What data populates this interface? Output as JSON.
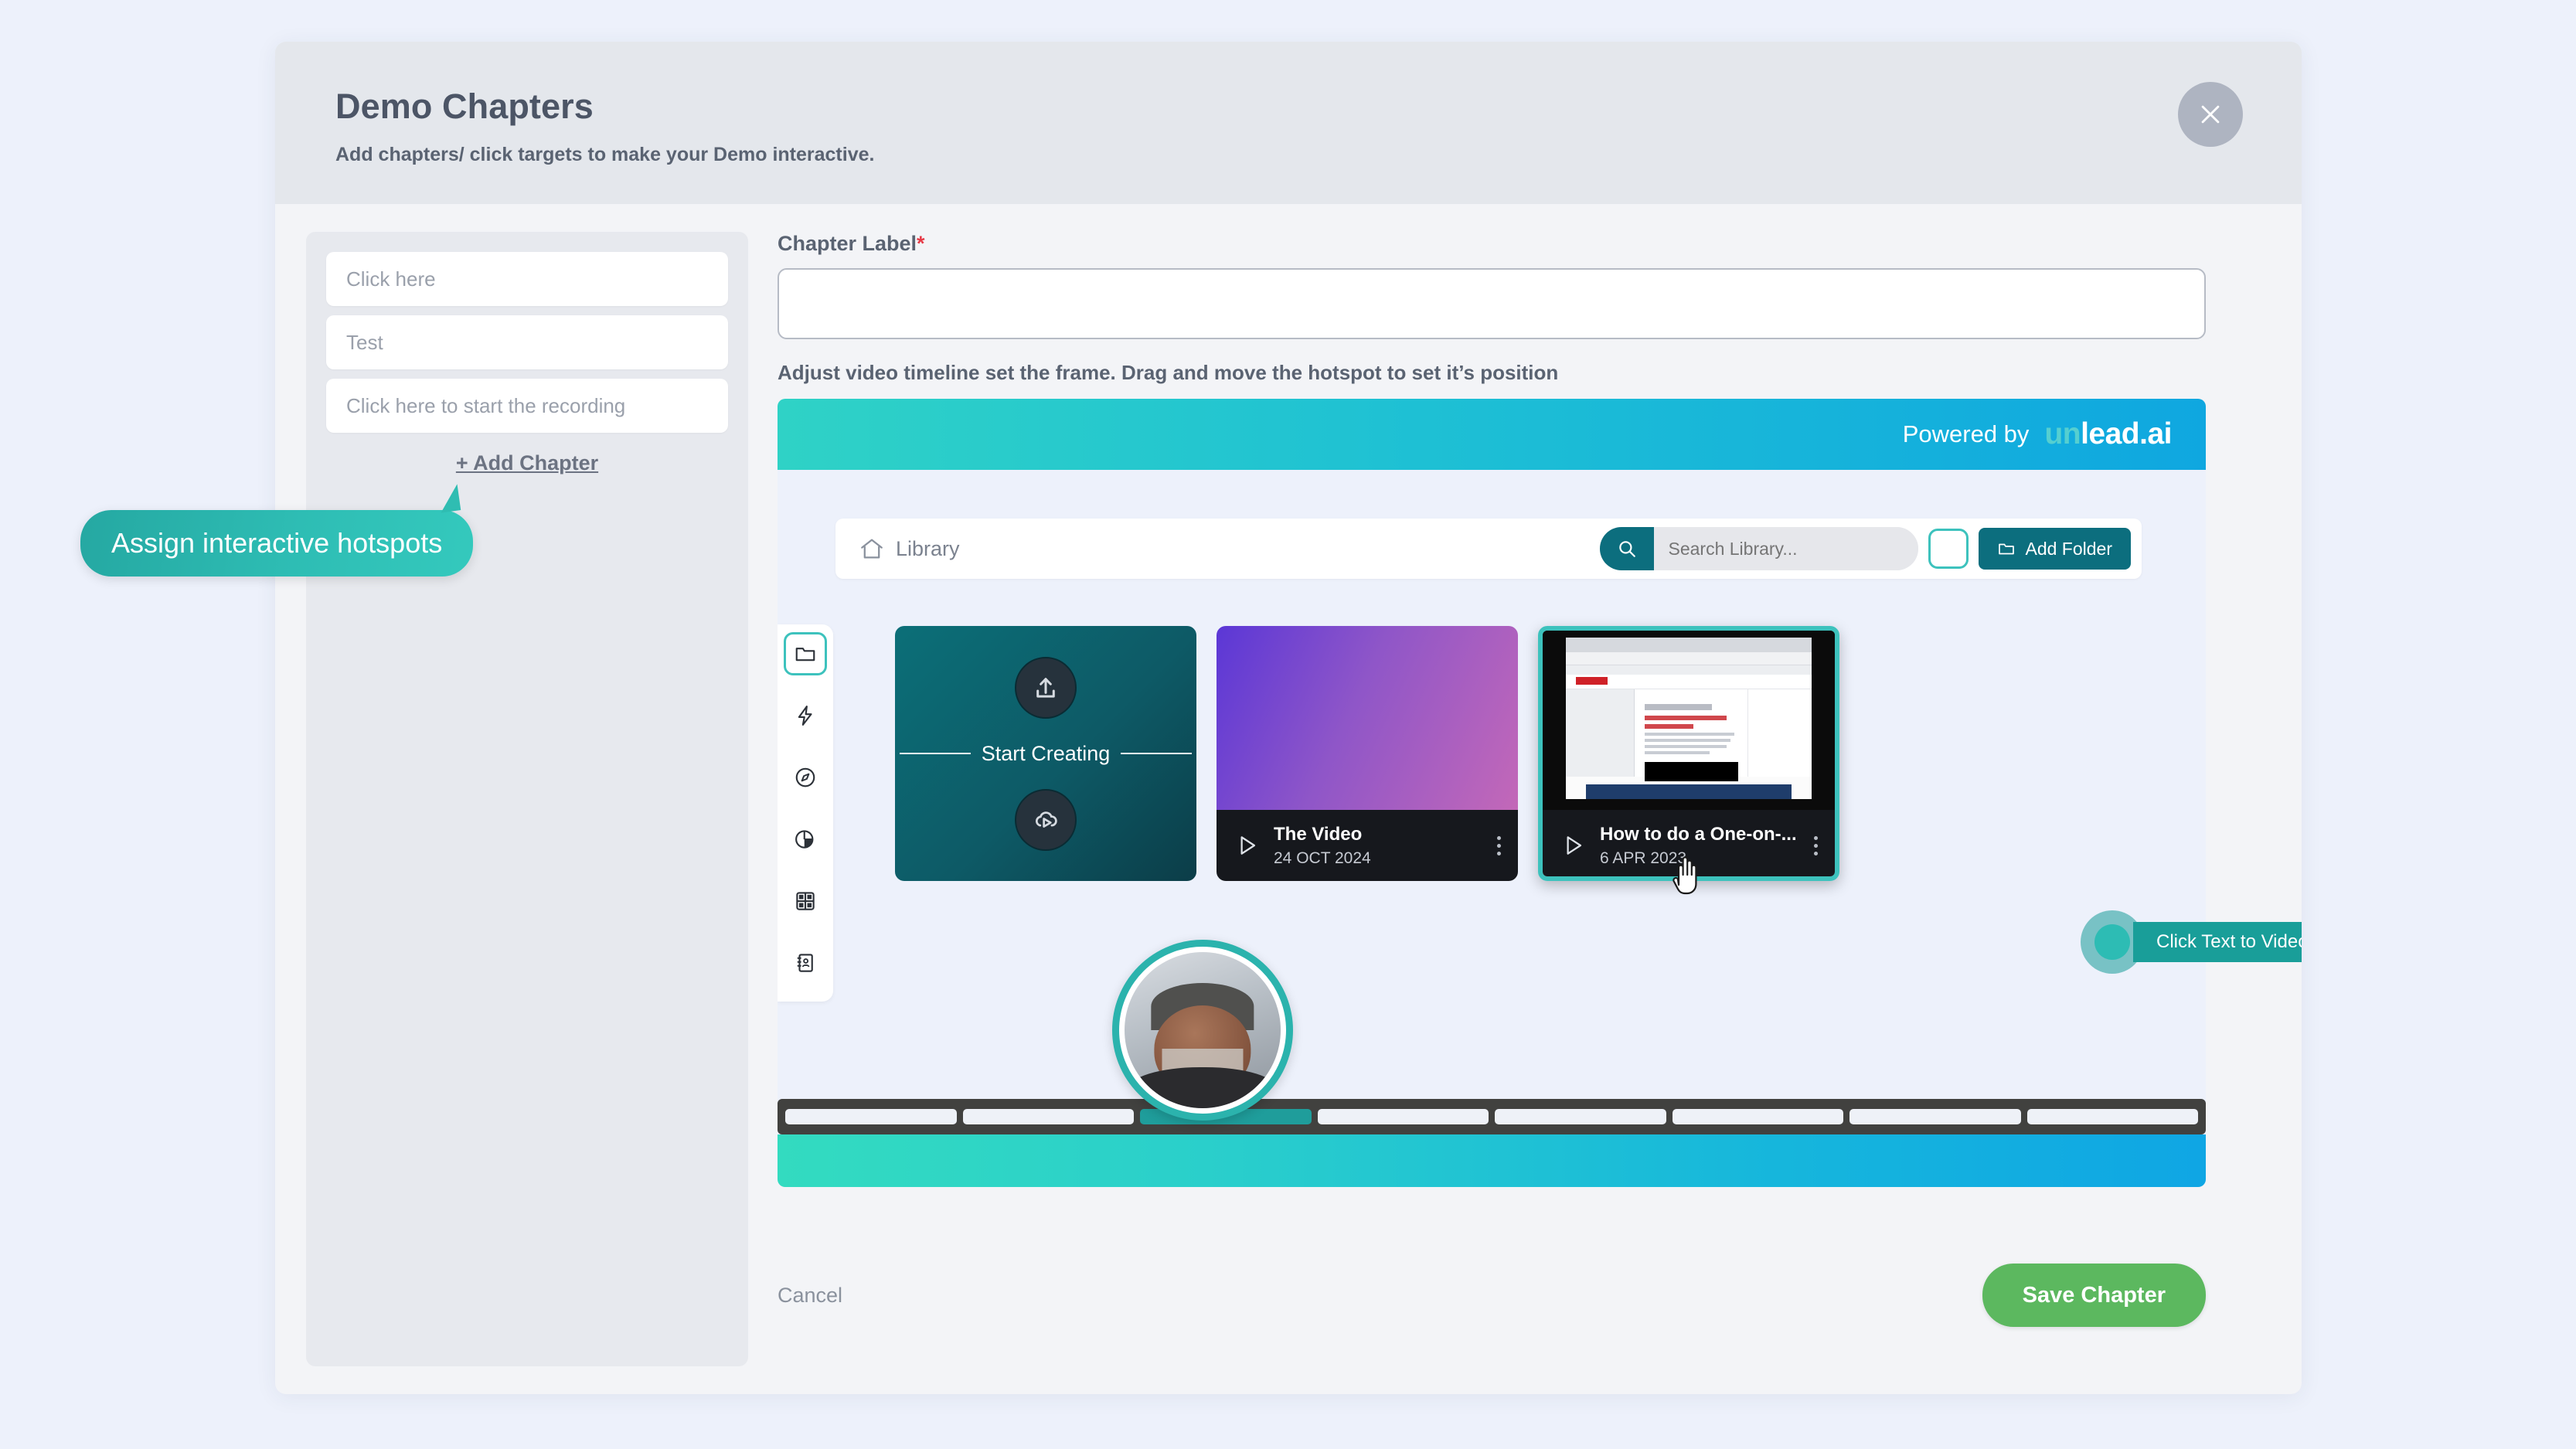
{
  "modal": {
    "title": "Demo Chapters",
    "subtitle": "Add chapters/ click targets to make your Demo interactive.",
    "close_label": "×"
  },
  "chapters_panel": {
    "items": [
      {
        "label": "Click here"
      },
      {
        "label": "Test"
      },
      {
        "label": "Click here to start the recording"
      }
    ],
    "add_chapter_label": "+  Add Chapter"
  },
  "callout": {
    "text": "Assign interactive hotspots"
  },
  "editor": {
    "chapter_label_text": "Chapter Label",
    "required_mark": "*",
    "chapter_value": "",
    "chapter_placeholder": "",
    "timeline_hint": "Adjust video timeline set the frame. Drag and move the hotspot to set it’s position"
  },
  "brand": {
    "powered_by": "Powered by",
    "logo_prefix": "un",
    "logo_suffix": "lead.ai"
  },
  "library": {
    "home_label": "Library",
    "search_value": "",
    "search_placeholder": "Search Library...",
    "search_icon": "search-icon",
    "square_button_label": "",
    "add_folder_label": "Add Folder",
    "add_folder_icon": "folder-icon"
  },
  "vtoolbar": {
    "items": [
      {
        "icon": "folder-icon",
        "active": true
      },
      {
        "icon": "lightning-bolt-icon",
        "active": false
      },
      {
        "icon": "compass-icon",
        "active": false
      },
      {
        "icon": "pie-chart-icon",
        "active": false
      },
      {
        "icon": "grid-icon",
        "active": false
      },
      {
        "icon": "contact-book-icon",
        "active": false
      }
    ]
  },
  "cards": [
    {
      "type": "start",
      "label": "Start Creating",
      "top_icon": "upload-icon",
      "bottom_icon": "cloud-play-icon"
    },
    {
      "type": "video",
      "title": "The Video",
      "date": "24 OCT 2024",
      "play_icon": "play-icon",
      "menu_icon": "kebab-menu-icon",
      "selected": false
    },
    {
      "type": "video",
      "title": "How to do a One-on-...",
      "date": "6 APR 2023",
      "play_icon": "play-icon",
      "menu_icon": "kebab-menu-icon",
      "selected": true
    }
  ],
  "hotspot": {
    "label": "Click Text to Video"
  },
  "timeline": {
    "segment_count": 8,
    "active_index": 2
  },
  "footer": {
    "cancel_label": "Cancel",
    "save_label": "Save Chapter"
  },
  "colors": {
    "page_bg": "#edf1fb",
    "modal_header": "#e4e7ec",
    "modal_body": "#f3f4f7",
    "teal": "#2bb3ad",
    "teal_dark": "#0c6e7e",
    "green": "#5cb85f",
    "required_red": "#e63946",
    "timeline_active": "#1f9d9b"
  }
}
